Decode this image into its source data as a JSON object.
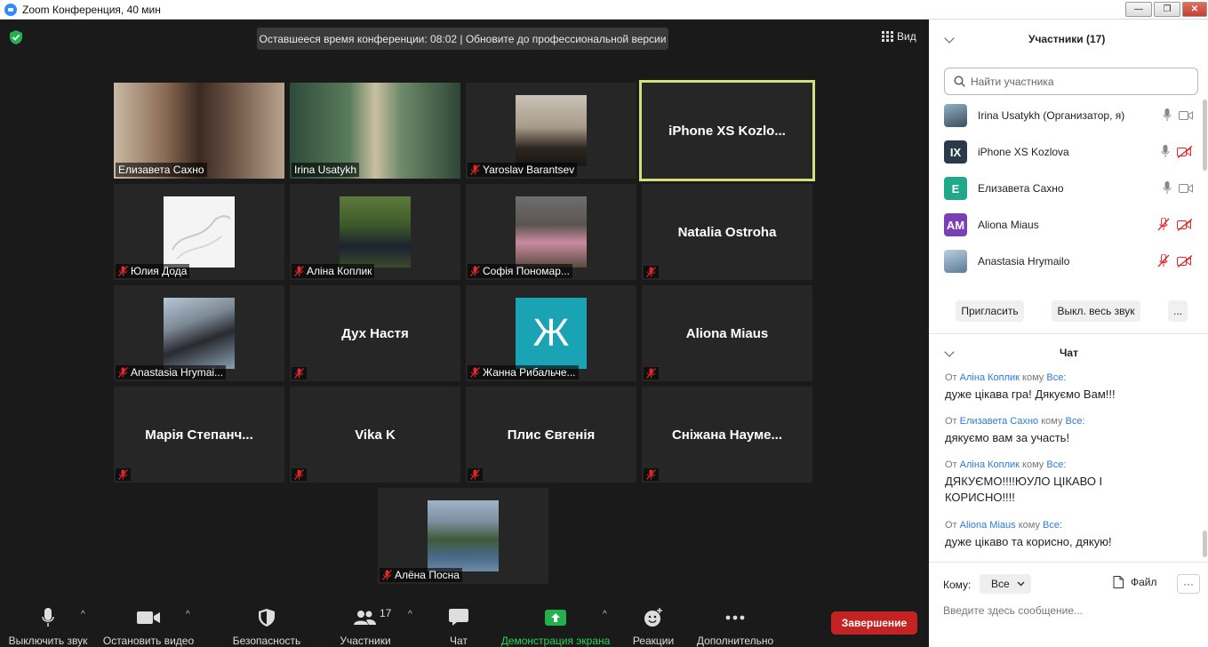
{
  "window": {
    "title": "Zoom Конференция, 40 мин",
    "minimize": "—",
    "maximize": "❐",
    "close": "✕"
  },
  "meeting": {
    "banner": "Оставшееся время конференции: 08:02 | Обновите до профессиональной версии",
    "view_label": "Вид"
  },
  "tiles": [
    {
      "name": "Елизавета Сахно",
      "video": true,
      "muted": false
    },
    {
      "name": "Irina Usatykh",
      "video": true,
      "muted": false
    },
    {
      "name": "Yaroslav Barantsev",
      "video": true,
      "muted": true
    },
    {
      "name": "iPhone XS Kozlo...",
      "video": false,
      "muted": false,
      "active": true
    },
    {
      "name": "Юлия Дода",
      "video": true,
      "muted": true
    },
    {
      "name": "Аліна Коплик",
      "video": true,
      "muted": true
    },
    {
      "name": "Софія Пономар...",
      "video": true,
      "muted": true
    },
    {
      "name": "Natalia Ostroha",
      "video": false,
      "muted": true
    },
    {
      "name": "Anastasia Hrymai...",
      "video": true,
      "muted": true
    },
    {
      "name": "Дух Настя",
      "video": false,
      "muted": true
    },
    {
      "name": "Жанна Рибальче...",
      "video": true,
      "muted": true,
      "letter": "Ж"
    },
    {
      "name": "Aliona Miaus",
      "video": false,
      "muted": true
    },
    {
      "name": "Марія  Степанч...",
      "video": false,
      "muted": true
    },
    {
      "name": "Vika K",
      "video": false,
      "muted": true
    },
    {
      "name": "Плис Євгенія",
      "video": false,
      "muted": true
    },
    {
      "name": "Сніжана  Науме...",
      "video": false,
      "muted": true
    },
    {
      "name": "Алёна Посна",
      "video": true,
      "muted": true
    }
  ],
  "toolbar": {
    "mute": "Выключить звук",
    "stop_video": "Остановить видео",
    "security": "Безопасность",
    "participants": "Участники",
    "participants_count": "17",
    "chat": "Чат",
    "share": "Демонстрация экрана",
    "reactions": "Реакции",
    "more": "Дополнительно",
    "end": "Завершение"
  },
  "participants_panel": {
    "title": "Участники (17)",
    "search_placeholder": "Найти участника",
    "list": [
      {
        "name": "Irina Usatykh (Организатор, я)",
        "initials": "",
        "color": "#5a7a8c",
        "mic_muted": false,
        "video_off": false
      },
      {
        "name": "iPhone XS Kozlova",
        "initials": "IX",
        "color": "#2a3a4a",
        "mic_muted": false,
        "video_off": true
      },
      {
        "name": "Елизавета Сахно",
        "initials": "Е",
        "color": "#1fa88a",
        "mic_muted": false,
        "video_off": false
      },
      {
        "name": "Aliona Miaus",
        "initials": "AM",
        "color": "#7a3fb5",
        "mic_muted": true,
        "video_off": true
      },
      {
        "name": "Anastasia Hrymailo",
        "initials": "",
        "color": "#6a8aa8",
        "mic_muted": true,
        "video_off": true
      }
    ],
    "invite": "Пригласить",
    "mute_all": "Выкл. весь звук",
    "more": "..."
  },
  "chat_panel": {
    "title": "Чат",
    "from_label": "От",
    "to_label": "кому",
    "messages": [
      {
        "from": "Аліна Коплик",
        "to": "Все:",
        "text": "дуже цікава гра! Дякуємо Вам!!!"
      },
      {
        "from": "Елизавета Сахно",
        "to": "Все:",
        "text": "дякуємо вам за участь!"
      },
      {
        "from": "Аліна Коплик",
        "to": "Все:",
        "text": "ДЯКУЄМО!!!!ЮУЛО ЦІКАВО І КОРИСНО!!!!"
      },
      {
        "from": "Aliona Miaus",
        "to": "Все:",
        "text": "дуже цікаво та корисно, дякую!"
      }
    ],
    "to_prefix": "Кому:",
    "to_value": "Все",
    "file_label": "Файл",
    "more": "···",
    "input_placeholder": "Введите здесь сообщение..."
  }
}
